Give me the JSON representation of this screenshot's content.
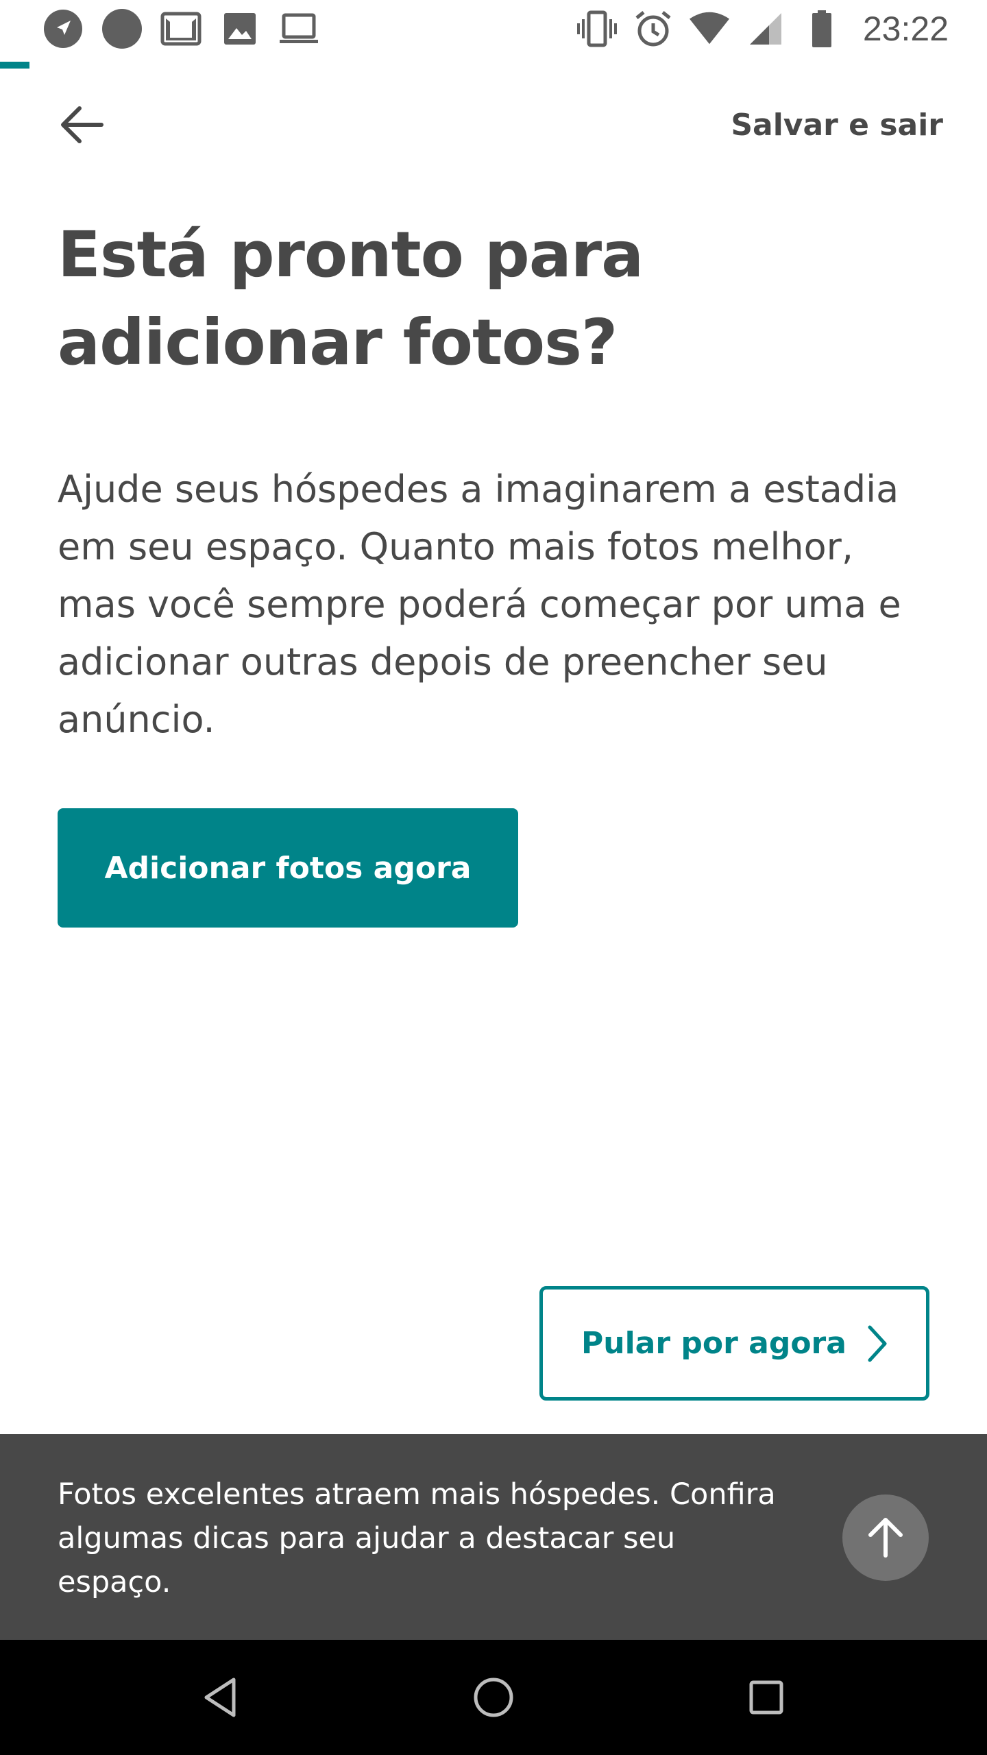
{
  "status_bar": {
    "time": "23:22",
    "left_icons": [
      "navigation-icon",
      "circle-notification-icon",
      "gmail-icon",
      "image-icon",
      "laptop-icon"
    ],
    "right_icons": [
      "vibrate-icon",
      "alarm-icon",
      "wifi-icon",
      "signal-icon",
      "battery-icon"
    ]
  },
  "progress": {
    "fraction": 0.03,
    "color": "#008489"
  },
  "header": {
    "back_icon": "arrow-left-icon",
    "save_exit_label": "Salvar e sair"
  },
  "main": {
    "title": "Está pronto para adicionar fotos?",
    "description": "Ajude seus hóspedes a imaginarem a estadia em seu espaço. Quanto mais fotos melhor, mas você sempre poderá começar por uma e adicionar outras depois de preencher seu anúncio.",
    "primary_button_label": "Adicionar fotos agora",
    "skip_button_label": "Pular por agora",
    "skip_icon": "chevron-right-icon"
  },
  "tips_banner": {
    "text": "Fotos excelentes atraem mais hóspedes. Confira algumas dicas para ajudar a destacar seu espaço.",
    "button_icon": "arrow-up-icon"
  },
  "colors": {
    "accent": "#008489",
    "text": "#484848",
    "banner": "#484848"
  },
  "nav_bar": {
    "icons": [
      "back-triangle-icon",
      "home-circle-icon",
      "recents-square-icon"
    ]
  }
}
